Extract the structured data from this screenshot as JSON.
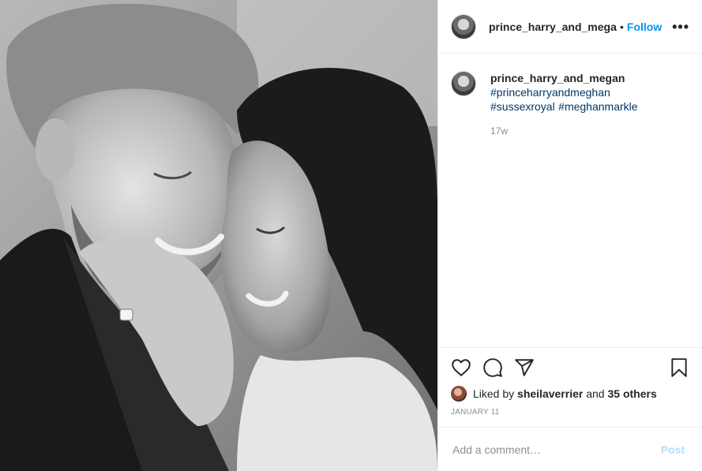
{
  "post": {
    "photo_icon": "black-and-white-couple-photo"
  },
  "header": {
    "username": "prince_harry_and_megan",
    "separator": "•",
    "follow_label": "Follow",
    "more_icon": "more-options-icon",
    "more_glyph": "•••"
  },
  "caption": {
    "username": "prince_harry_and_megan",
    "hashtags": [
      "#princeharryandmeghan",
      "#sussexroyal",
      "#meghanmarkle"
    ],
    "time": "17w"
  },
  "actions": {
    "like_icon": "heart-icon",
    "comment_icon": "comment-icon",
    "share_icon": "share-icon",
    "save_icon": "bookmark-icon"
  },
  "likes": {
    "prefix": "Liked by",
    "user": "sheilaverrier",
    "and": "and",
    "others": "35 others"
  },
  "date": "JANUARY 11",
  "comment": {
    "placeholder": "Add a comment…",
    "post_label": "Post"
  },
  "colors": {
    "link": "#0095f6",
    "hashtag": "#00376b",
    "muted": "#8e8e8e",
    "post_disabled": "#b2dffc"
  }
}
